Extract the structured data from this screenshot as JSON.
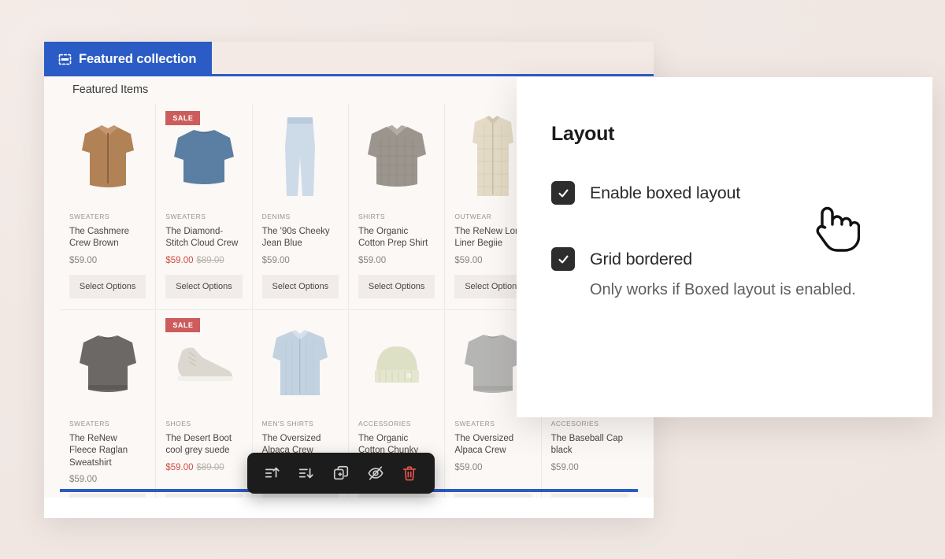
{
  "editor": {
    "tab": {
      "label": "Featured collection",
      "icon": "section-collection-icon"
    },
    "section_heading": "Featured Items",
    "select_options_label": "Select Options",
    "sale_badge": "SALE"
  },
  "products_row1": [
    {
      "category": "SWEATERS",
      "title": "The Cashmere Crew Brown",
      "price": "$59.00",
      "on_sale": false,
      "compare_price": "",
      "image": "brown-zip-sweater",
      "color": "#b08256"
    },
    {
      "category": "SWEATERS",
      "title": "The Diamond-Stitch Cloud Crew",
      "price": "$59.00",
      "on_sale": true,
      "compare_price": "$89.00",
      "image": "blue-crew-sweater",
      "color": "#5b7fa3"
    },
    {
      "category": "DENIMS",
      "title": "The '90s Cheeky Jean Blue",
      "price": "$59.00",
      "on_sale": false,
      "compare_price": "",
      "image": "light-blue-jeans",
      "color": "#cddbe8"
    },
    {
      "category": "SHIRTS",
      "title": "The Organic Cotton Prep Shirt",
      "price": "$59.00",
      "on_sale": false,
      "compare_price": "",
      "image": "checked-prep-shirt",
      "color": "#9b958d"
    },
    {
      "category": "OUTWEAR",
      "title": "The ReNew Long Liner Begiie",
      "price": "$59.00",
      "on_sale": false,
      "compare_price": "",
      "image": "cream-quilted-coat",
      "color": "#e3dbc6"
    },
    {
      "category": "",
      "title": "",
      "price": "",
      "on_sale": false,
      "compare_price": "",
      "image": "hidden-card",
      "color": "#ffffff"
    }
  ],
  "products_row2": [
    {
      "category": "SWEATERS",
      "title": "The ReNew Fleece Raglan Sweatshirt",
      "price": "$59.00",
      "on_sale": false,
      "compare_price": "",
      "image": "dark-grey-sweatshirt",
      "color": "#6b6865"
    },
    {
      "category": "SHOES",
      "title": "The Desert Boot cool grey suede",
      "price": "$59.00",
      "on_sale": true,
      "compare_price": "$89.00",
      "image": "desert-boot",
      "color": "#ddd8cf"
    },
    {
      "category": "MEN'S SHIRTS",
      "title": "The Oversized Alpaca Crew",
      "price": "",
      "on_sale": false,
      "compare_price": "",
      "image": "light-blue-shirt",
      "color": "#c3d2e0"
    },
    {
      "category": "ACCESSORIES",
      "title": "The Organic Cotton Chunky Beanie",
      "price": "",
      "on_sale": false,
      "compare_price": "",
      "image": "cream-beanie",
      "color": "#dde0c4"
    },
    {
      "category": "SWEATERS",
      "title": "The Oversized Alpaca Crew",
      "price": "$59.00",
      "on_sale": false,
      "compare_price": "",
      "image": "grey-alpaca-crew",
      "color": "#b5b5b3"
    },
    {
      "category": "ACCESORIES",
      "title": "The Baseball Cap black",
      "price": "$59.00",
      "on_sale": false,
      "compare_price": "",
      "image": "baseball-cap",
      "color": "#ffffff"
    }
  ],
  "toolbar": {
    "items": [
      {
        "name": "move-up-icon",
        "title": "Move up"
      },
      {
        "name": "move-down-icon",
        "title": "Move down"
      },
      {
        "name": "duplicate-icon",
        "title": "Duplicate"
      },
      {
        "name": "hide-icon",
        "title": "Hide"
      },
      {
        "name": "delete-icon",
        "title": "Delete"
      }
    ]
  },
  "layout_panel": {
    "title": "Layout",
    "options": [
      {
        "label": "Enable boxed layout",
        "checked": true,
        "help": ""
      },
      {
        "label": "Grid bordered",
        "checked": true,
        "help": "Only works if Boxed layout is enabled."
      }
    ]
  },
  "colors": {
    "accent_blue": "#2b5bc4",
    "sale_red": "#cd5c5c",
    "price_sale_red": "#d24b3e",
    "delete_red": "#e8544a",
    "background": "#f2eae6",
    "panel_dark": "#1c1c1c"
  }
}
